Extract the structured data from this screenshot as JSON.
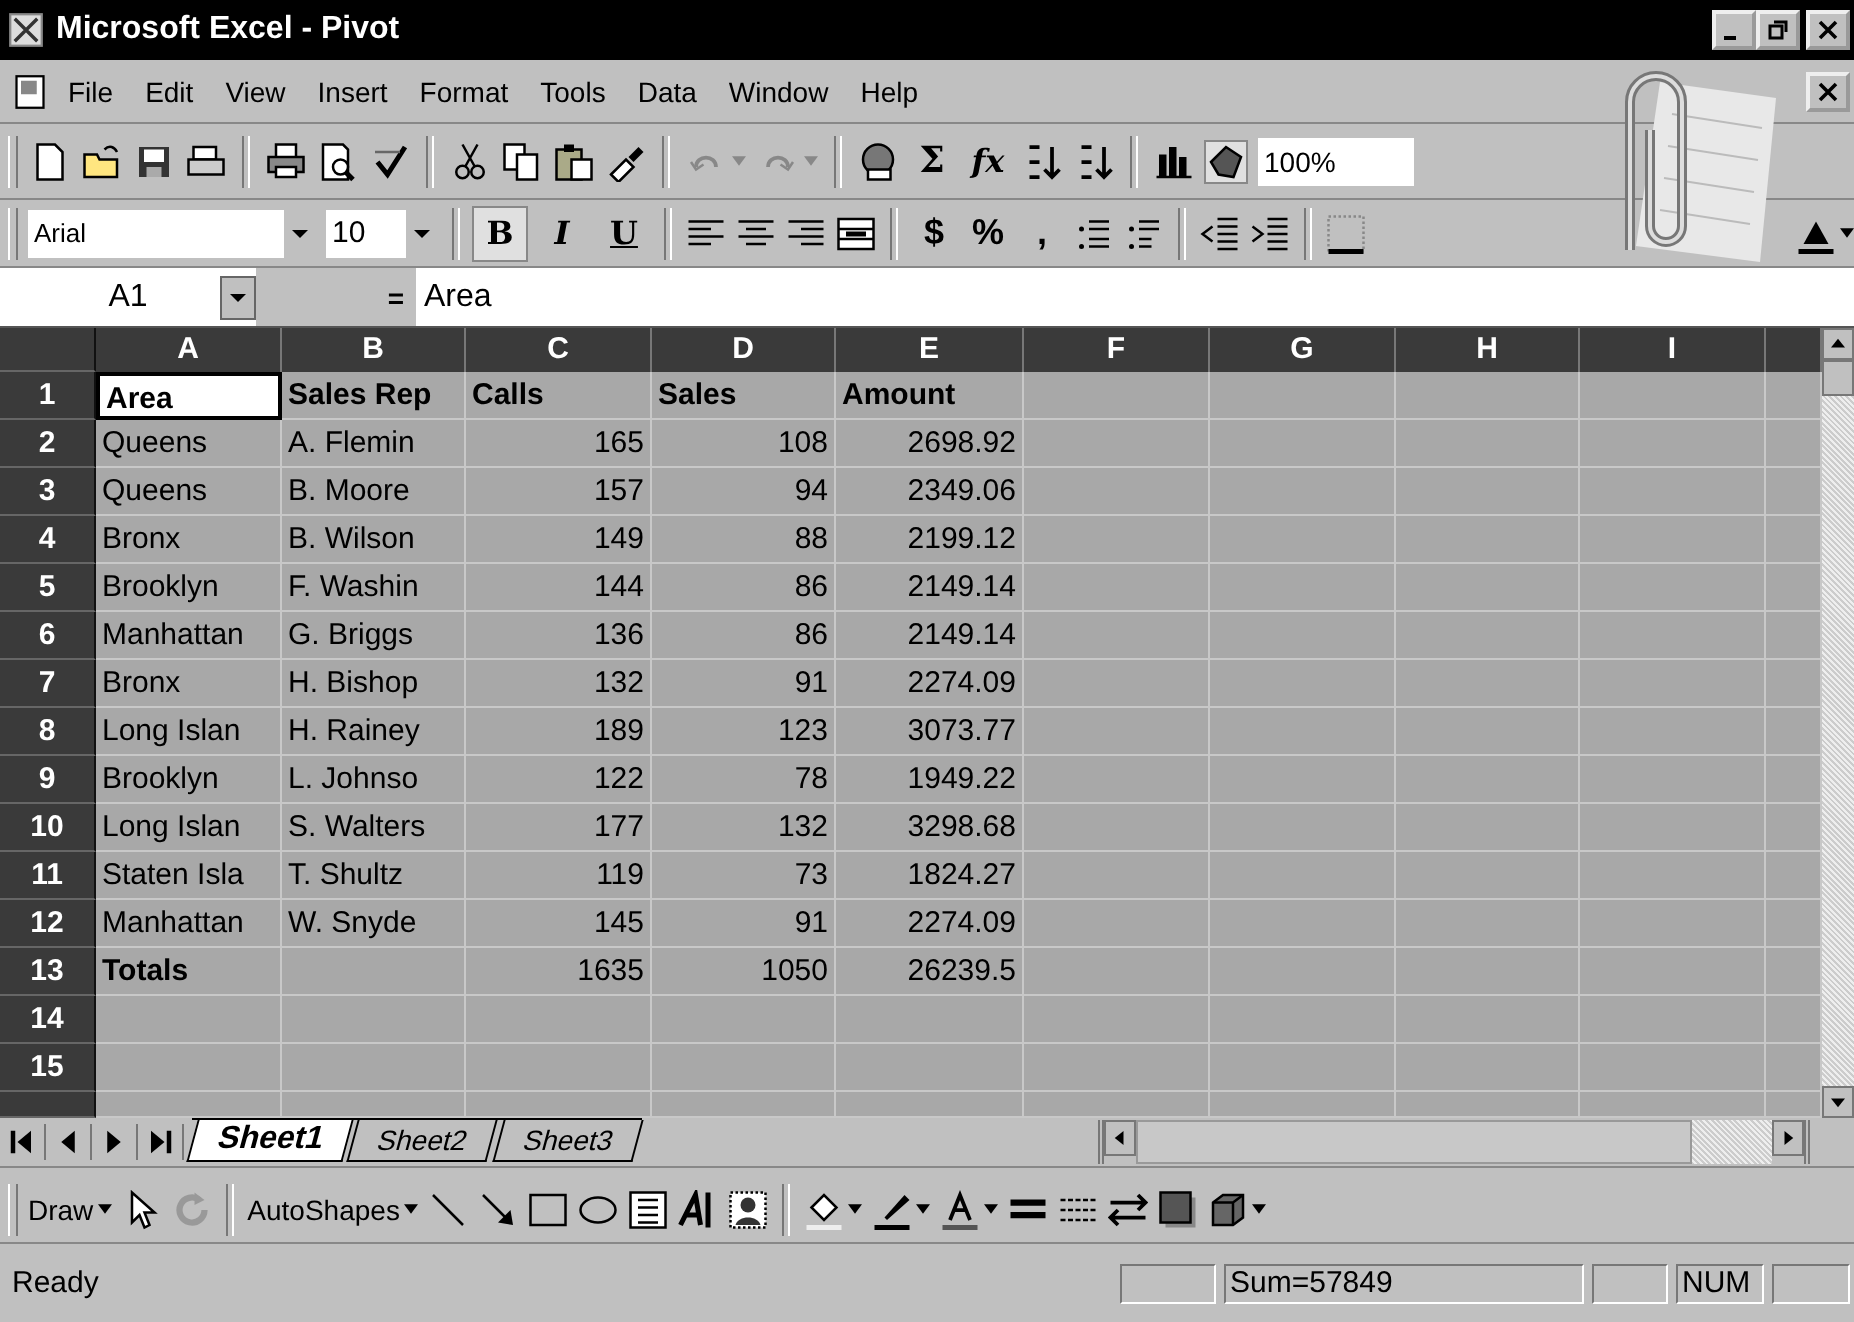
{
  "window": {
    "title": "Microsoft Excel - Pivot"
  },
  "menu": [
    {
      "label": "File"
    },
    {
      "label": "Edit"
    },
    {
      "label": "View"
    },
    {
      "label": "Insert"
    },
    {
      "label": "Format"
    },
    {
      "label": "Tools"
    },
    {
      "label": "Data"
    },
    {
      "label": "Window"
    },
    {
      "label": "Help"
    }
  ],
  "standard_toolbar": {
    "sum": "Σ",
    "function": "fx",
    "zoom": "100%"
  },
  "formatting_toolbar": {
    "font": "Arial",
    "size": "10",
    "style_buttons": [
      {
        "label": "B",
        "pressed": true
      },
      {
        "label": "I",
        "pressed": false
      },
      {
        "label": "U",
        "pressed": false
      }
    ],
    "number_buttons": [
      "$",
      "%",
      ","
    ]
  },
  "formula_bar": {
    "name_box": "A1",
    "equals": "=",
    "value": "Area"
  },
  "sheet": {
    "columns": [
      "A",
      "B",
      "C",
      "D",
      "E",
      "F",
      "G",
      "H",
      "I"
    ],
    "rows": [
      {
        "number": "1",
        "cells": [
          {
            "text": "Area",
            "active": true,
            "bold": true
          },
          {
            "text": "Sales Rep",
            "active": false,
            "bold": true
          },
          {
            "text": "Calls",
            "active": false,
            "bold": true
          },
          {
            "text": "Sales",
            "active": false,
            "bold": true
          },
          {
            "text": "Amount",
            "active": false,
            "bold": true
          }
        ]
      },
      {
        "number": "2",
        "cells": [
          {
            "text": "Queens",
            "active": false,
            "bold": false
          },
          {
            "text": "A. Flemin",
            "active": false,
            "bold": false
          },
          {
            "text": "165",
            "active": false,
            "bold": false
          },
          {
            "text": "108",
            "active": false,
            "bold": false
          },
          {
            "text": "2698.92",
            "active": false,
            "bold": false
          }
        ]
      },
      {
        "number": "3",
        "cells": [
          {
            "text": "Queens",
            "active": false,
            "bold": false
          },
          {
            "text": "B. Moore",
            "active": false,
            "bold": false
          },
          {
            "text": "157",
            "active": false,
            "bold": false
          },
          {
            "text": "94",
            "active": false,
            "bold": false
          },
          {
            "text": "2349.06",
            "active": false,
            "bold": false
          }
        ]
      },
      {
        "number": "4",
        "cells": [
          {
            "text": "Bronx",
            "active": false,
            "bold": false
          },
          {
            "text": "B. Wilson",
            "active": false,
            "bold": false
          },
          {
            "text": "149",
            "active": false,
            "bold": false
          },
          {
            "text": "88",
            "active": false,
            "bold": false
          },
          {
            "text": "2199.12",
            "active": false,
            "bold": false
          }
        ]
      },
      {
        "number": "5",
        "cells": [
          {
            "text": "Brooklyn",
            "active": false,
            "bold": false
          },
          {
            "text": "F. Washin",
            "active": false,
            "bold": false
          },
          {
            "text": "144",
            "active": false,
            "bold": false
          },
          {
            "text": "86",
            "active": false,
            "bold": false
          },
          {
            "text": "2149.14",
            "active": false,
            "bold": false
          }
        ]
      },
      {
        "number": "6",
        "cells": [
          {
            "text": "Manhattan",
            "active": false,
            "bold": false
          },
          {
            "text": "G. Briggs",
            "active": false,
            "bold": false
          },
          {
            "text": "136",
            "active": false,
            "bold": false
          },
          {
            "text": "86",
            "active": false,
            "bold": false
          },
          {
            "text": "2149.14",
            "active": false,
            "bold": false
          }
        ]
      },
      {
        "number": "7",
        "cells": [
          {
            "text": "Bronx",
            "active": false,
            "bold": false
          },
          {
            "text": "H. Bishop",
            "active": false,
            "bold": false
          },
          {
            "text": "132",
            "active": false,
            "bold": false
          },
          {
            "text": "91",
            "active": false,
            "bold": false
          },
          {
            "text": "2274.09",
            "active": false,
            "bold": false
          }
        ]
      },
      {
        "number": "8",
        "cells": [
          {
            "text": "Long Islan",
            "active": false,
            "bold": false
          },
          {
            "text": "H. Rainey",
            "active": false,
            "bold": false
          },
          {
            "text": "189",
            "active": false,
            "bold": false
          },
          {
            "text": "123",
            "active": false,
            "bold": false
          },
          {
            "text": "3073.77",
            "active": false,
            "bold": false
          }
        ]
      },
      {
        "number": "9",
        "cells": [
          {
            "text": "Brooklyn",
            "active": false,
            "bold": false
          },
          {
            "text": "L. Johnso",
            "active": false,
            "bold": false
          },
          {
            "text": "122",
            "active": false,
            "bold": false
          },
          {
            "text": "78",
            "active": false,
            "bold": false
          },
          {
            "text": "1949.22",
            "active": false,
            "bold": false
          }
        ]
      },
      {
        "number": "10",
        "cells": [
          {
            "text": "Long Islan",
            "active": false,
            "bold": false
          },
          {
            "text": "S. Walters",
            "active": false,
            "bold": false
          },
          {
            "text": "177",
            "active": false,
            "bold": false
          },
          {
            "text": "132",
            "active": false,
            "bold": false
          },
          {
            "text": "3298.68",
            "active": false,
            "bold": false
          }
        ]
      },
      {
        "number": "11",
        "cells": [
          {
            "text": "Staten Isla",
            "active": false,
            "bold": false
          },
          {
            "text": "T. Shultz",
            "active": false,
            "bold": false
          },
          {
            "text": "119",
            "active": false,
            "bold": false
          },
          {
            "text": "73",
            "active": false,
            "bold": false
          },
          {
            "text": "1824.27",
            "active": false,
            "bold": false
          }
        ]
      },
      {
        "number": "12",
        "cells": [
          {
            "text": "Manhattan",
            "active": false,
            "bold": false
          },
          {
            "text": "W. Snyde",
            "active": false,
            "bold": false
          },
          {
            "text": "145",
            "active": false,
            "bold": false
          },
          {
            "text": "91",
            "active": false,
            "bold": false
          },
          {
            "text": "2274.09",
            "active": false,
            "bold": false
          }
        ]
      },
      {
        "number": "13",
        "cells": [
          {
            "text": "Totals",
            "active": false,
            "bold": true
          },
          {
            "active": false
          },
          {
            "text": "1635",
            "active": false,
            "bold": false
          },
          {
            "text": "1050",
            "active": false,
            "bold": false
          },
          {
            "text": "26239.5",
            "active": false,
            "bold": false
          }
        ]
      },
      {
        "number": "14",
        "cells": []
      },
      {
        "number": "15",
        "cells": []
      }
    ]
  },
  "sheet_tabs": [
    {
      "label": "Sheet1",
      "selected": true
    },
    {
      "label": "Sheet2",
      "selected": false
    },
    {
      "label": "Sheet3",
      "selected": false
    }
  ],
  "drawing_toolbar": {
    "draw": "Draw",
    "autoshapes": "AutoShapes"
  },
  "status_bar": {
    "mode": "Ready",
    "sum": "Sum=57849",
    "num": "NUM"
  }
}
